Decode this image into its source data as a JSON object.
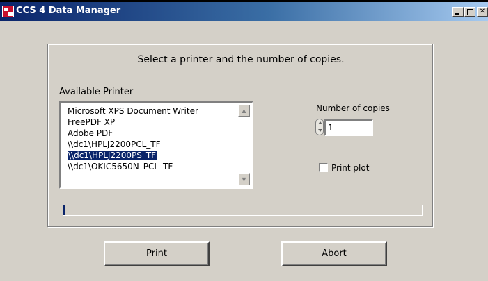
{
  "window": {
    "title": "CCS 4 Data Manager",
    "app_icon": "ccs-app-icon",
    "controls": [
      "minimize-icon",
      "maximize-icon",
      "close-icon"
    ],
    "close_glyph": "✕"
  },
  "dialog": {
    "instruction": "Select a printer and the number of copies.",
    "available_printer_label": "Available Printer",
    "printers": [
      {
        "name": "Microsoft XPS Document Writer",
        "selected": false
      },
      {
        "name": "FreePDF XP",
        "selected": false
      },
      {
        "name": "Adobe PDF",
        "selected": false
      },
      {
        "name": "\\\\dc1\\HPLJ2200PCL_TF",
        "selected": false
      },
      {
        "name": "\\\\dc1\\HPLJ2200PS_TF",
        "selected": true
      },
      {
        "name": "\\\\dc1\\OKIC5650N_PCL_TF",
        "selected": false
      }
    ],
    "scroll_up_glyph": "▲",
    "scroll_down_glyph": "▼",
    "copies_label": "Number of copies",
    "copies_value": "1",
    "print_plot_label": "Print plot",
    "print_plot_checked": false,
    "progress": 0.004
  },
  "buttons": {
    "print_label": "Print",
    "abort_label": "Abort"
  },
  "colors": {
    "titlebar_start": "#0a246a",
    "titlebar_end": "#a6caf0",
    "selection": "#0a246a",
    "dialog_bg": "#d4d0c8"
  }
}
